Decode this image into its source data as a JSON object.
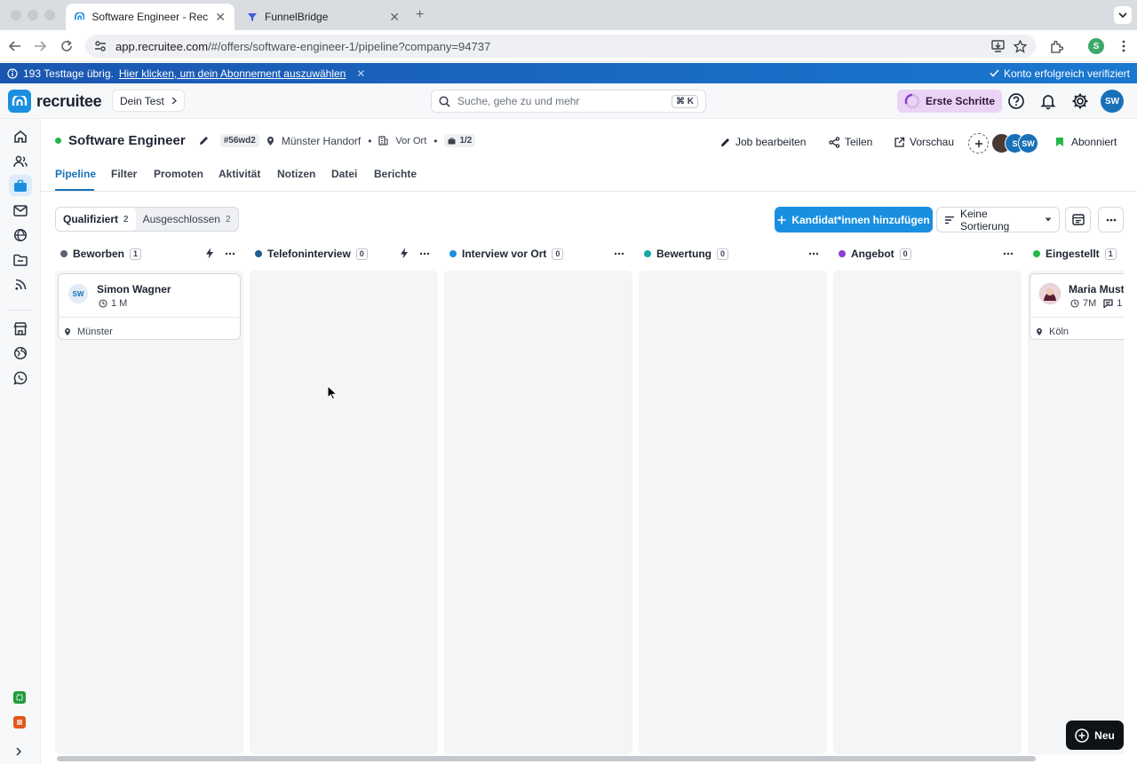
{
  "browser": {
    "tabs": [
      {
        "title": "Software Engineer - Recruitee",
        "close": "✕"
      },
      {
        "title": "FunnelBridge",
        "close": "✕"
      }
    ],
    "new_tab": "+",
    "url_host": "app.recruitee.com",
    "url_path": "/#/offers/software-engineer-1/pipeline?company=94737",
    "profile_initial": "S"
  },
  "banner": {
    "trial_text": "193 Testtage übrig.",
    "link": "Hier klicken, um dein Abonnement auszuwählen",
    "close": "✕",
    "verified": "Konto erfolgreich verifiziert"
  },
  "app": {
    "brand": "recruitee",
    "company": "Dein Test",
    "search_placeholder": "Suche, gehe zu und mehr",
    "shortcut": "⌘ K",
    "first_steps": "Erste Schritte",
    "user_initials": "SW"
  },
  "job": {
    "title": "Software Engineer",
    "code": "#56wd2",
    "location": "Münster Handorf",
    "work_mode": "Vor Ort",
    "openings": "1/2",
    "actions": {
      "edit": "Job bearbeiten",
      "share": "Teilen",
      "preview": "Vorschau",
      "subscribed": "Abonniert"
    },
    "team_initials": [
      "S",
      "SW"
    ]
  },
  "tabs": [
    "Pipeline",
    "Filter",
    "Promoten",
    "Aktivität",
    "Notizen",
    "Datei",
    "Berichte"
  ],
  "toolbar": {
    "qualified": "Qualifiziert",
    "qualified_count": "2",
    "excluded": "Ausgeschlossen",
    "excluded_count": "2",
    "add_candidates": "Kandidat*innen hinzufügen",
    "sort": "Keine Sortierung"
  },
  "columns": [
    {
      "name": "Beworben",
      "count": "1",
      "color": "#5b6270"
    },
    {
      "name": "Telefoninterview",
      "count": "0",
      "color": "#1f5f8f"
    },
    {
      "name": "Interview vor Ort",
      "count": "0",
      "color": "#1a8fe0"
    },
    {
      "name": "Bewertung",
      "count": "0",
      "color": "#14a7a7"
    },
    {
      "name": "Angebot",
      "count": "0",
      "color": "#8a3fd1"
    },
    {
      "name": "Eingestellt",
      "count": "1",
      "color": "#21b84a"
    }
  ],
  "cards": [
    {
      "initials": "SW",
      "name": "Simon Wagner",
      "time": "1 M",
      "city": "Münster"
    },
    {
      "name": "Maria Must",
      "time": "7M",
      "comments": "1",
      "city": "Köln"
    }
  ],
  "new_button": "Neu"
}
